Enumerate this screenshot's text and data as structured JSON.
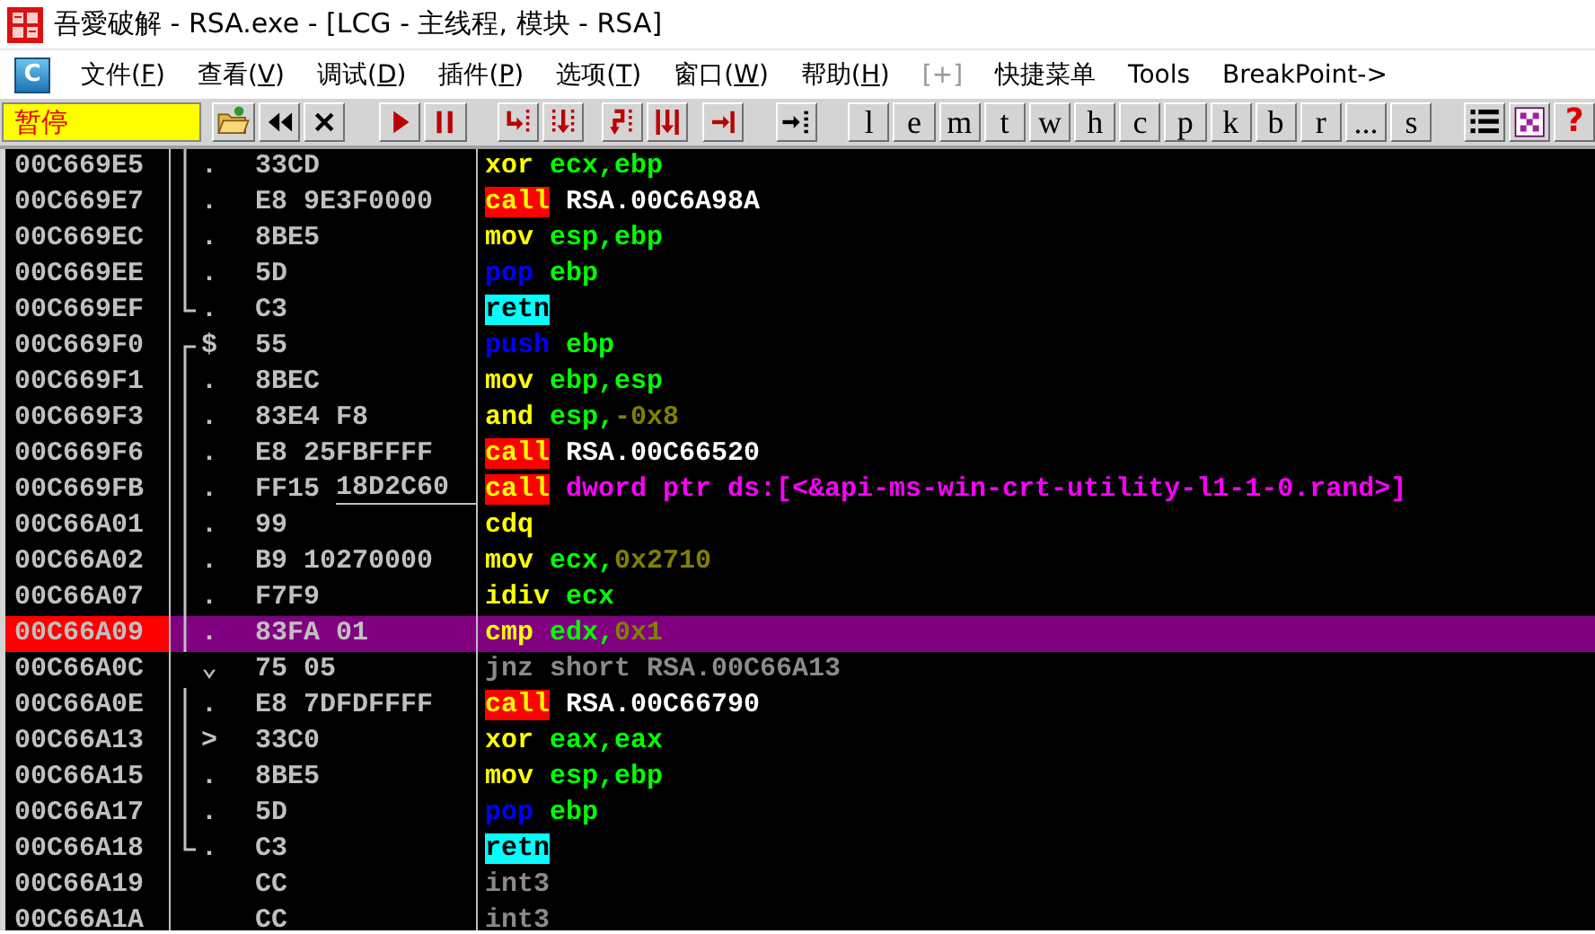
{
  "window": {
    "title": "吾愛破解 - RSA.exe - [LCG -  主线程, 模块 - RSA]"
  },
  "menu": {
    "logo_letter": "C",
    "items": [
      {
        "before": "文件(",
        "accel": "F",
        "after": ")",
        "disabled": false
      },
      {
        "before": "查看(",
        "accel": "V",
        "after": ")",
        "disabled": false
      },
      {
        "before": "调试(",
        "accel": "D",
        "after": ")",
        "disabled": false
      },
      {
        "before": "插件(",
        "accel": "P",
        "after": ")",
        "disabled": false
      },
      {
        "before": "选项(",
        "accel": "T",
        "after": ")",
        "disabled": false
      },
      {
        "before": "窗口(",
        "accel": "W",
        "after": ")",
        "disabled": false
      },
      {
        "before": "帮助(",
        "accel": "H",
        "after": ")",
        "disabled": false
      },
      {
        "before": "[+]",
        "disabled": true
      },
      {
        "before": "快捷菜单",
        "disabled": false
      },
      {
        "before": "Tools",
        "disabled": false
      },
      {
        "before": "BreakPoint->",
        "disabled": false
      }
    ]
  },
  "toolbar": {
    "status": "暂停",
    "letter_buttons": [
      "l",
      "e",
      "m",
      "t",
      "w",
      "h",
      "c",
      "p",
      "k",
      "b",
      "r",
      "...",
      "s"
    ],
    "help": "?"
  },
  "disassembly": {
    "rows": [
      {
        "address": "00C669E5",
        "kind": "bracket-mid",
        "mark": ".",
        "hex": "33CD",
        "selected": false,
        "mnemonic": {
          "text": "xor",
          "kind": "op"
        },
        "operands": [
          {
            "text": "ecx,ebp",
            "kind": "reg"
          }
        ]
      },
      {
        "address": "00C669E7",
        "kind": "bracket-mid",
        "mark": ".",
        "hex": "E8 9E3F0000",
        "selected": false,
        "mnemonic": {
          "text": "call",
          "kind": "call"
        },
        "operands": [
          {
            "text": "RSA.00C6A98A",
            "kind": "label"
          }
        ]
      },
      {
        "address": "00C669EC",
        "kind": "bracket-mid",
        "mark": ".",
        "hex": "8BE5",
        "selected": false,
        "mnemonic": {
          "text": "mov",
          "kind": "op"
        },
        "operands": [
          {
            "text": "esp,ebp",
            "kind": "reg"
          }
        ]
      },
      {
        "address": "00C669EE",
        "kind": "bracket-mid",
        "mark": ".",
        "hex": "5D",
        "selected": false,
        "mnemonic": {
          "text": "pop",
          "kind": "stack"
        },
        "operands": [
          {
            "text": "ebp",
            "kind": "reg"
          }
        ]
      },
      {
        "address": "00C669EF",
        "kind": "bracket-end",
        "mark": ".",
        "hex": "C3",
        "selected": false,
        "mnemonic": {
          "text": "retn",
          "kind": "ret"
        },
        "operands": []
      },
      {
        "address": "00C669F0",
        "kind": "bracket-start",
        "mark": "$",
        "hex": "55",
        "selected": false,
        "mnemonic": {
          "text": "push",
          "kind": "stack"
        },
        "operands": [
          {
            "text": "ebp",
            "kind": "reg"
          }
        ]
      },
      {
        "address": "00C669F1",
        "kind": "bracket-mid",
        "mark": ".",
        "hex": "8BEC",
        "selected": false,
        "mnemonic": {
          "text": "mov",
          "kind": "op"
        },
        "operands": [
          {
            "text": "ebp,esp",
            "kind": "reg"
          }
        ]
      },
      {
        "address": "00C669F3",
        "kind": "bracket-mid",
        "mark": ".",
        "hex": "83E4 F8",
        "selected": false,
        "mnemonic": {
          "text": "and",
          "kind": "op"
        },
        "operands": [
          {
            "text": "esp,",
            "kind": "reg"
          },
          {
            "text": "-0x8",
            "kind": "num"
          }
        ]
      },
      {
        "address": "00C669F6",
        "kind": "bracket-mid",
        "mark": ".",
        "hex": "E8 25FBFFFF",
        "selected": false,
        "mnemonic": {
          "text": "call",
          "kind": "call"
        },
        "operands": [
          {
            "text": "RSA.00C66520",
            "kind": "label"
          }
        ]
      },
      {
        "address": "00C669FB",
        "kind": "bracket-mid",
        "mark": ".",
        "hex": "FF15",
        "hex_link": "18D2C60",
        "selected": false,
        "mnemonic": {
          "text": "call",
          "kind": "call"
        },
        "operands": [
          {
            "text": "dword ptr ds:[<&api-ms-win-crt-utility-l1-1-0.rand>]",
            "kind": "api"
          }
        ]
      },
      {
        "address": "00C66A01",
        "kind": "bracket-mid",
        "mark": ".",
        "hex": "99",
        "selected": false,
        "mnemonic": {
          "text": "cdq",
          "kind": "op"
        },
        "operands": []
      },
      {
        "address": "00C66A02",
        "kind": "bracket-mid",
        "mark": ".",
        "hex": "B9 10270000",
        "selected": false,
        "mnemonic": {
          "text": "mov",
          "kind": "op"
        },
        "operands": [
          {
            "text": "ecx,",
            "kind": "reg"
          },
          {
            "text": "0x2710",
            "kind": "num"
          }
        ]
      },
      {
        "address": "00C66A07",
        "kind": "bracket-mid",
        "mark": ".",
        "hex": "F7F9",
        "selected": false,
        "mnemonic": {
          "text": "idiv",
          "kind": "op"
        },
        "operands": [
          {
            "text": "ecx",
            "kind": "reg"
          }
        ]
      },
      {
        "address": "00C66A09",
        "kind": "bracket-mid",
        "mark": ".",
        "hex": "83FA 01",
        "selected": true,
        "mnemonic": {
          "text": "cmp",
          "kind": "op"
        },
        "operands": [
          {
            "text": "edx,",
            "kind": "reg"
          },
          {
            "text": "0x1",
            "kind": "num"
          }
        ]
      },
      {
        "address": "00C66A0C",
        "kind": "plain",
        "mark": "⌄",
        "hex": "75 05",
        "selected": false,
        "mnemonic": {
          "text": "jnz",
          "kind": "jump"
        },
        "operands": [
          {
            "text": "short RSA.00C66A13",
            "kind": "dim"
          }
        ]
      },
      {
        "address": "00C66A0E",
        "kind": "bracket-mid",
        "mark": ".",
        "hex": "E8 7DFDFFFF",
        "selected": false,
        "mnemonic": {
          "text": "call",
          "kind": "call"
        },
        "operands": [
          {
            "text": "RSA.00C66790",
            "kind": "label"
          }
        ]
      },
      {
        "address": "00C66A13",
        "kind": "bracket-mid",
        "mark": ">",
        "hex": "33C0",
        "selected": false,
        "mnemonic": {
          "text": "xor",
          "kind": "op"
        },
        "operands": [
          {
            "text": "eax,eax",
            "kind": "reg"
          }
        ]
      },
      {
        "address": "00C66A15",
        "kind": "bracket-mid",
        "mark": ".",
        "hex": "8BE5",
        "selected": false,
        "mnemonic": {
          "text": "mov",
          "kind": "op"
        },
        "operands": [
          {
            "text": "esp,ebp",
            "kind": "reg"
          }
        ]
      },
      {
        "address": "00C66A17",
        "kind": "bracket-mid",
        "mark": ".",
        "hex": "5D",
        "selected": false,
        "mnemonic": {
          "text": "pop",
          "kind": "stack"
        },
        "operands": [
          {
            "text": "ebp",
            "kind": "reg"
          }
        ]
      },
      {
        "address": "00C66A18",
        "kind": "bracket-end",
        "mark": ".",
        "hex": "C3",
        "selected": false,
        "mnemonic": {
          "text": "retn",
          "kind": "ret"
        },
        "operands": []
      },
      {
        "address": "00C66A19",
        "kind": "plain",
        "hex": "CC",
        "selected": false,
        "mnemonic": {
          "text": "int3",
          "kind": "jump"
        },
        "operands": []
      },
      {
        "address": "00C66A1A",
        "kind": "plain",
        "hex": "CC",
        "selected": false,
        "mnemonic": {
          "text": "int3",
          "kind": "jump"
        },
        "operands": []
      }
    ]
  }
}
